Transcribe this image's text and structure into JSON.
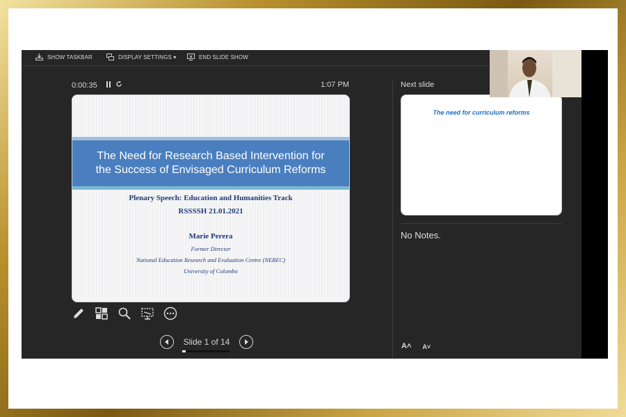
{
  "toolbar": {
    "show_taskbar": "SHOW TASKBAR",
    "display_settings": "DISPLAY SETTINGS ▾",
    "end_slide_show": "END SLIDE SHOW"
  },
  "timer": {
    "elapsed": "0:00:35",
    "clock": "1:07 PM"
  },
  "current_slide": {
    "title_line1": "The Need for Research Based Intervention for",
    "title_line2": "the Success of Envisaged Curriculum Reforms",
    "line1": "Plenary Speech: Education and Humanities Track",
    "line2": "RSSSSH 21.01.2021",
    "line3": "Marie Perera",
    "line4": "Former Director",
    "line5": "National Education Research and Evaluation Centre (NEREC)",
    "line6": "University of Colombo"
  },
  "navigation": {
    "slide_counter": "Slide 1 of 14",
    "progress_fraction": 0.071
  },
  "next_slide": {
    "label": "Next slide",
    "title": "The need for curriculum reforms"
  },
  "notes": {
    "text": "No Notes."
  },
  "font_controls": {
    "increase": "A˄",
    "decrease": "A˅"
  },
  "icons": [
    "taskbar-icon",
    "display-icon",
    "end-show-icon",
    "pause-icon",
    "reset-icon",
    "pen-icon",
    "grid-icon",
    "zoom-icon",
    "subtitle-icon",
    "more-icon",
    "prev-arrow-icon",
    "next-arrow-icon"
  ]
}
